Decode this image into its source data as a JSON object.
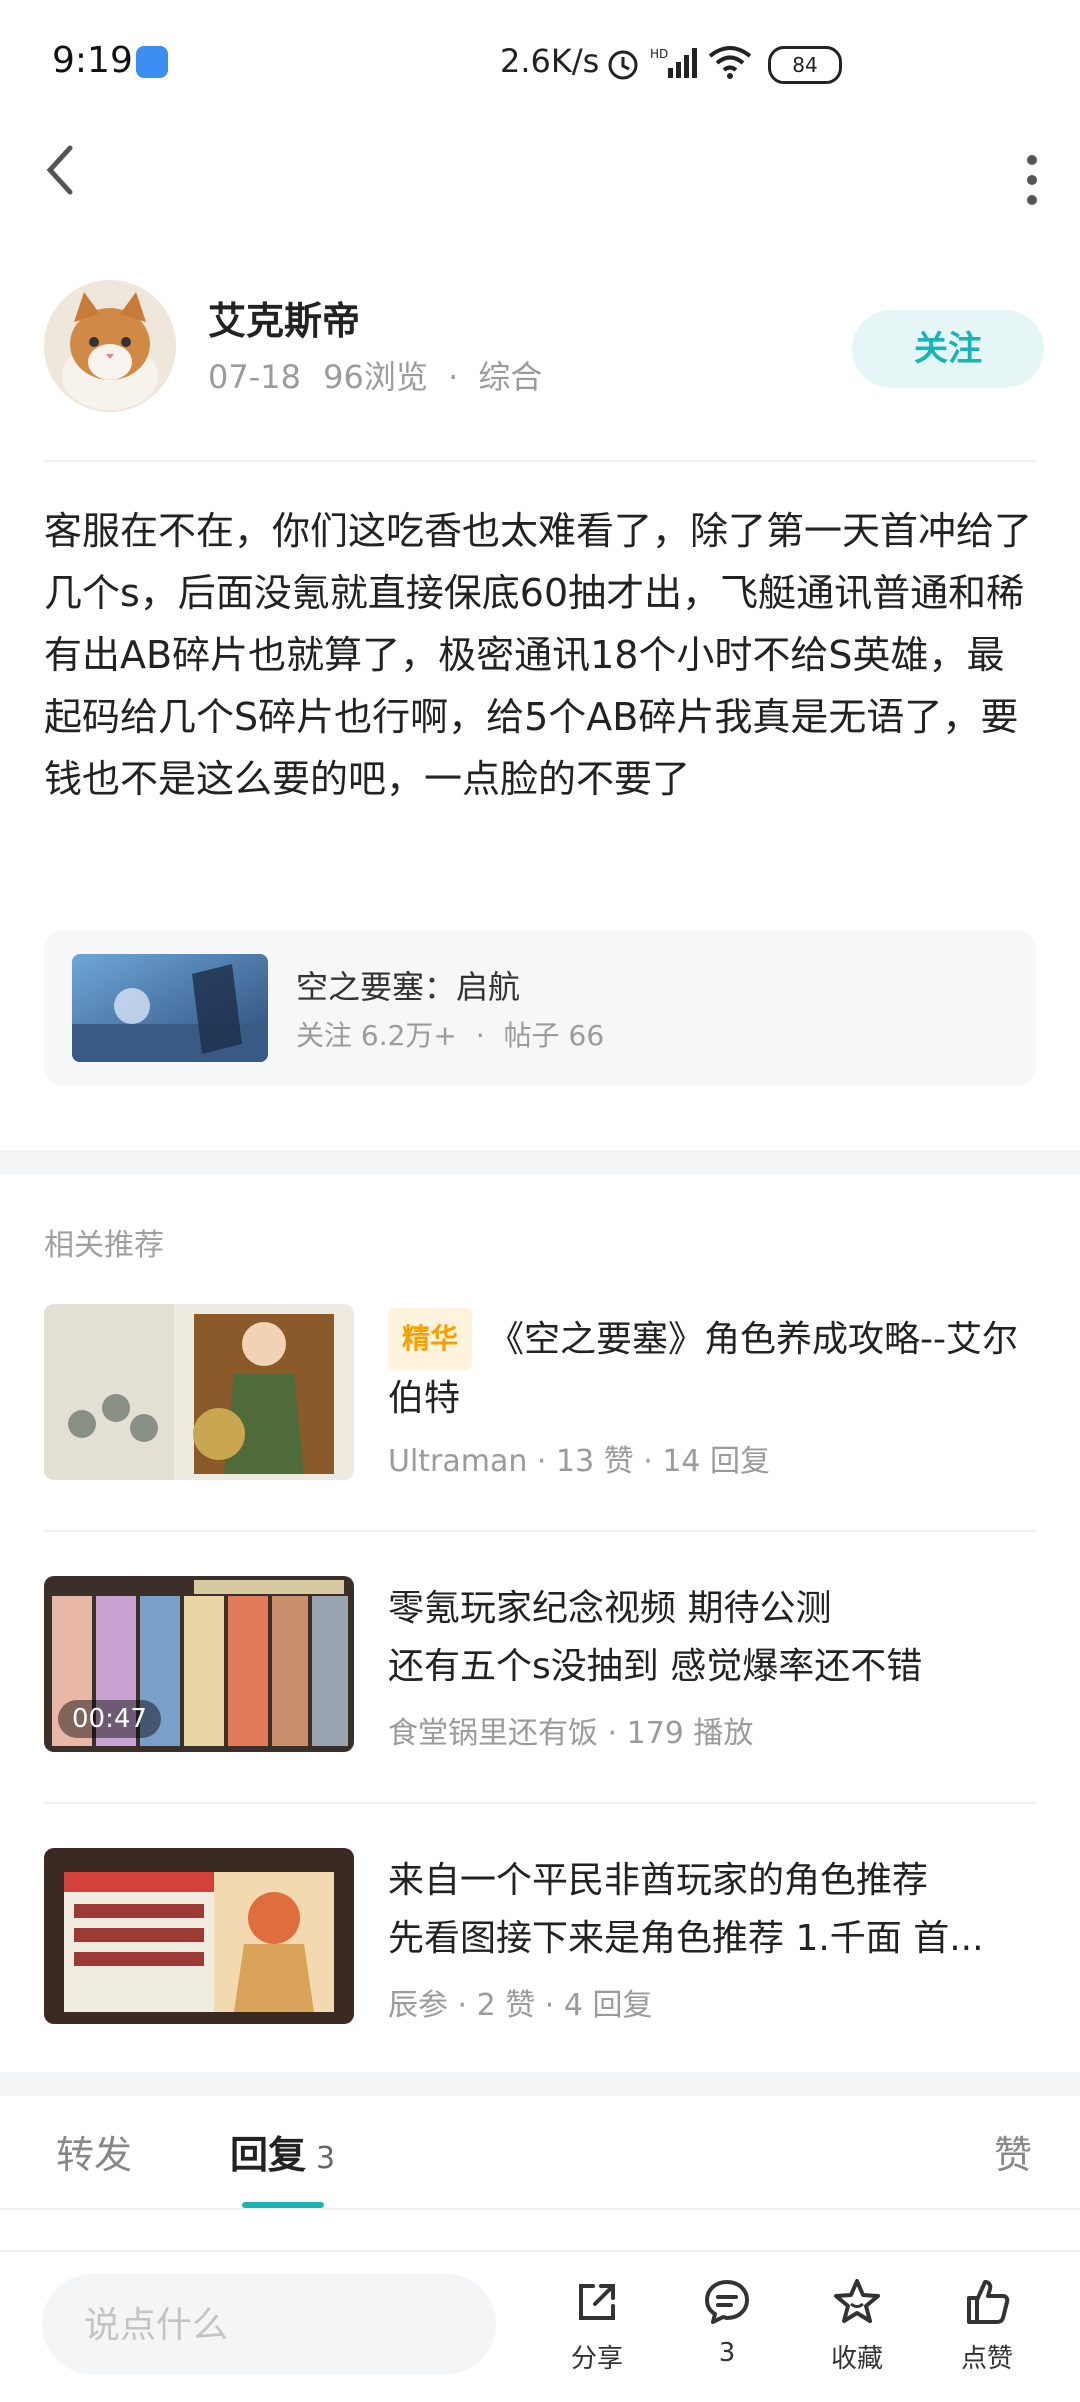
{
  "status_bar": {
    "time": "9:19",
    "net_speed": "2.6K/s",
    "battery": "84"
  },
  "author": {
    "name": "艾克斯帝",
    "date": "07-18",
    "views": "96浏览",
    "category": "综合",
    "follow_label": "关注"
  },
  "post": {
    "content": "客服在不在，你们这吃香也太难看了，除了第一天首冲给了几个s，后面没氪就直接保底60抽才出，飞艇通讯普通和稀有出AB碎片也就算了，极密通讯18个小时不给S英雄，最起码给几个S碎片也行啊，给5个AB碎片我真是无语了，要钱也不是这么要的吧，一点脸的不要了"
  },
  "game": {
    "title": "空之要塞：启航",
    "followers": "关注 6.2万+",
    "posts": "帖子 66"
  },
  "related": {
    "heading": "相关推荐",
    "items": [
      {
        "tag": "精华",
        "title": "《空之要塞》角色养成攻略--艾尔伯特",
        "meta": "Ultraman · 13 赞 · 14 回复"
      },
      {
        "title": "零氪玩家纪念视频 期待公测\n还有五个s没抽到 感觉爆率还不错",
        "duration": "00:47",
        "meta": "食堂锅里还有饭 · 179 播放"
      },
      {
        "title": "来自一个平民非酋玩家的角色推荐\n先看图接下来是角色推荐 1.千面 首...",
        "meta": "辰参 · 2 赞 · 4 回复"
      }
    ]
  },
  "tabs": {
    "repost": "转发",
    "reply": "回复",
    "reply_count": "3",
    "like": "赞"
  },
  "bottom": {
    "placeholder": "说点什么",
    "share": "分享",
    "comment_count": "3",
    "favorite": "收藏",
    "like": "点赞"
  },
  "colors": {
    "accent": "#19b5b5",
    "tag_bg": "#fff3dd",
    "tag_fg": "#f5a000"
  }
}
